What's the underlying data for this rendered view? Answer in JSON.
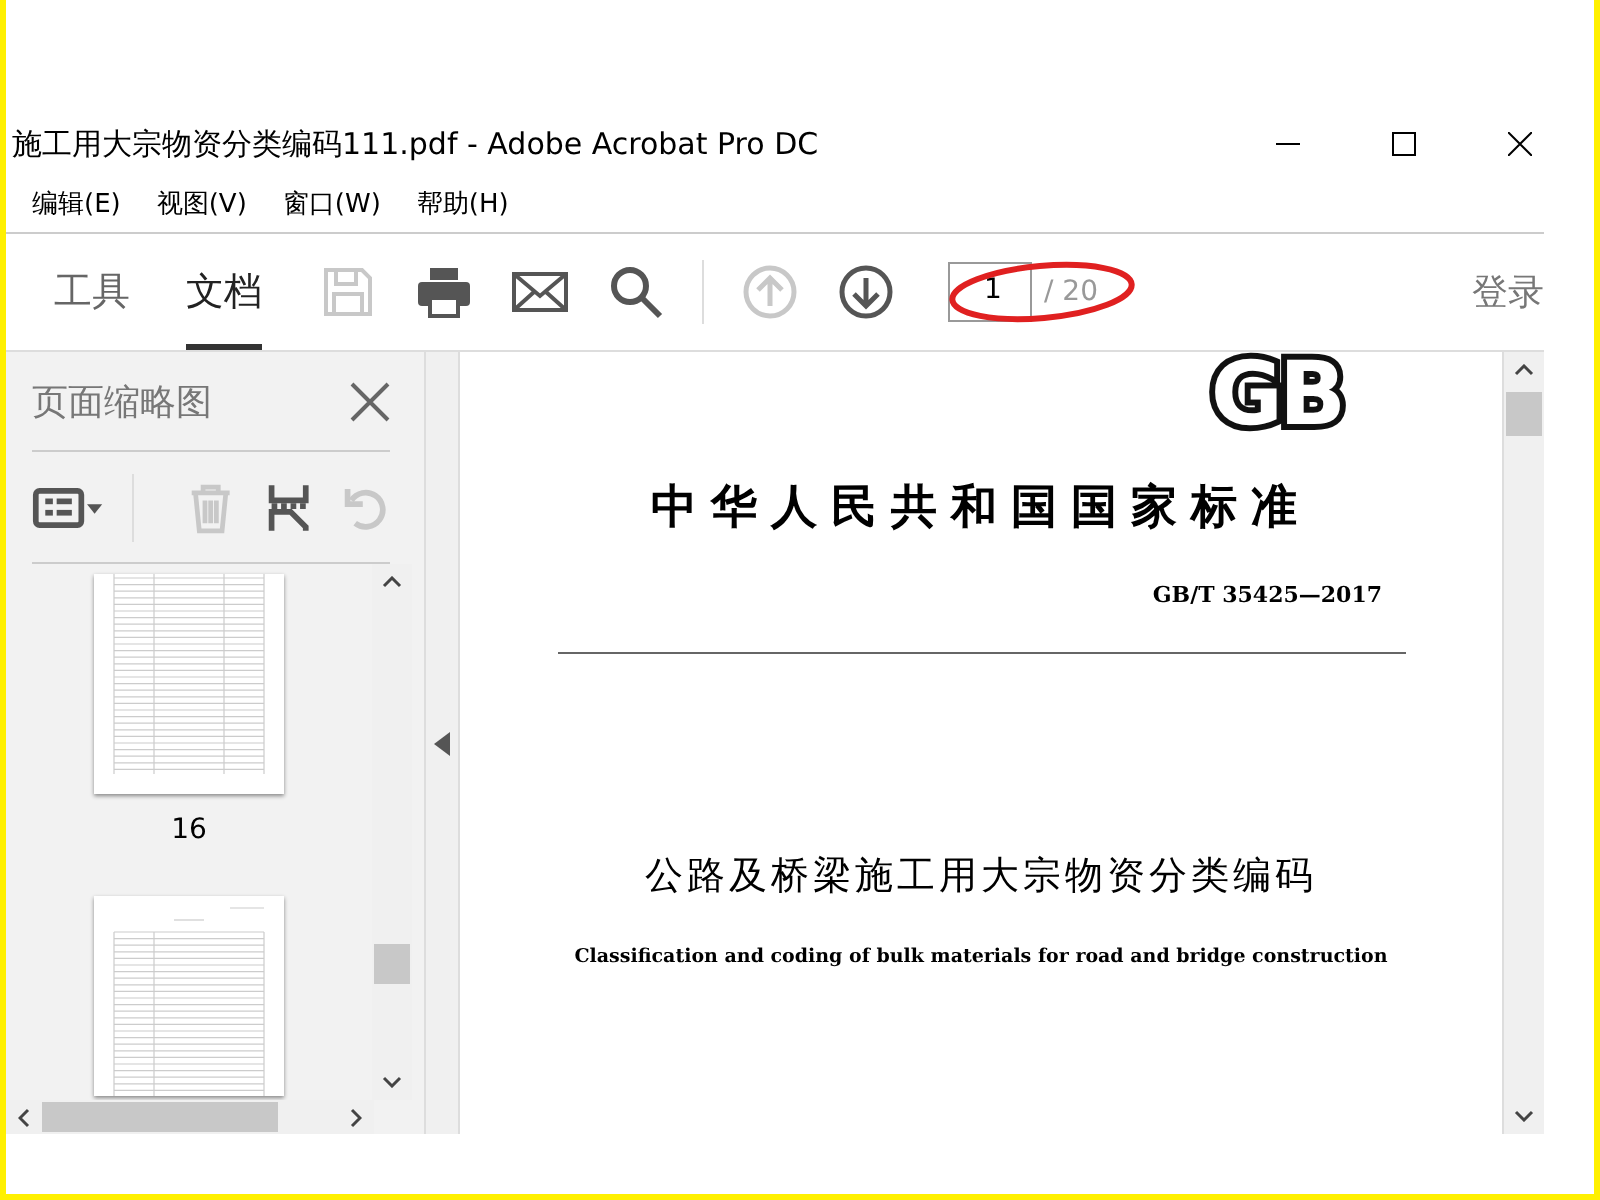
{
  "window": {
    "title": "施工用大宗物资分类编码111.pdf - Adobe Acrobat Pro DC"
  },
  "menu": [
    {
      "label": "编辑(E)"
    },
    {
      "label": "视图(V)"
    },
    {
      "label": "窗口(W)"
    },
    {
      "label": "帮助(H)"
    }
  ],
  "toolbar": {
    "tabs": [
      {
        "label": "工具",
        "selected": false
      },
      {
        "label": "文档",
        "selected": true
      }
    ],
    "tools": [
      {
        "kind": "save",
        "disabled": true
      },
      {
        "kind": "print",
        "disabled": false
      },
      {
        "kind": "mail",
        "disabled": false
      },
      {
        "kind": "search",
        "disabled": false
      },
      {
        "kind": "up",
        "disabled": true
      },
      {
        "kind": "down",
        "disabled": false
      }
    ],
    "page_field": {
      "value": "1",
      "total": "/ 20"
    },
    "sign_in": "登录"
  },
  "thumbnail_panel": {
    "title": "页面缩略图",
    "tools": [
      {
        "kind": "options",
        "disabled": false
      },
      {
        "kind": "delete",
        "disabled": true
      },
      {
        "kind": "extract",
        "disabled": false
      },
      {
        "kind": "undo",
        "disabled": true
      }
    ],
    "pages": [
      {
        "label": "16"
      }
    ]
  },
  "document": {
    "logo": "GB",
    "heading": "中华人民共和国国家标准",
    "code": "GB/T 35425—2017",
    "title_cn": "公路及桥梁施工用大宗物资分类编码",
    "title_en": "Classification and coding of bulk materials for road and bridge construction"
  }
}
